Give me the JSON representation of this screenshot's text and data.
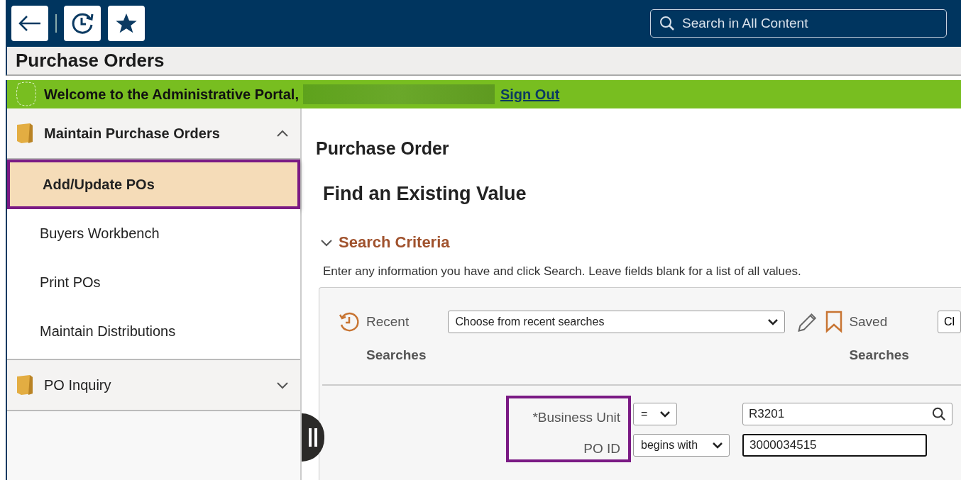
{
  "header": {
    "search": {
      "placeholder": "Search in All Content"
    }
  },
  "page_title": "Purchase Orders",
  "welcome_bar": {
    "text": "Welcome to the Administrative Portal,",
    "link": "Sign Out"
  },
  "sidebar": {
    "groups": [
      {
        "label": "Maintain Purchase Orders",
        "expanded": true,
        "children": [
          {
            "label": "Add/Update POs",
            "selected": true
          },
          {
            "label": "Buyers Workbench",
            "selected": false
          },
          {
            "label": "Print POs",
            "selected": false
          },
          {
            "label": "Maintain Distributions",
            "selected": false
          }
        ]
      },
      {
        "label": "PO Inquiry",
        "expanded": false
      }
    ]
  },
  "main": {
    "title": "Purchase Order",
    "subtitle": "Find an Existing Value",
    "section": {
      "label": "Search Criteria",
      "expanded": true
    },
    "instructions": "Enter any information you have and click Search. Leave fields blank for a list of all values.",
    "recent": {
      "label_1": "Recent",
      "label_2": "Searches",
      "dropdown": "Choose from recent searches"
    },
    "saved": {
      "label_1": "Saved",
      "label_2": "Searches",
      "button": "Cl"
    },
    "criteria": [
      {
        "label": "*Business Unit",
        "operator": "=",
        "value": "R3201",
        "lookup": true,
        "focused": false
      },
      {
        "label": "PO ID",
        "operator": "begins with",
        "value": "3000034515",
        "lookup": false,
        "focused": true
      }
    ]
  }
}
